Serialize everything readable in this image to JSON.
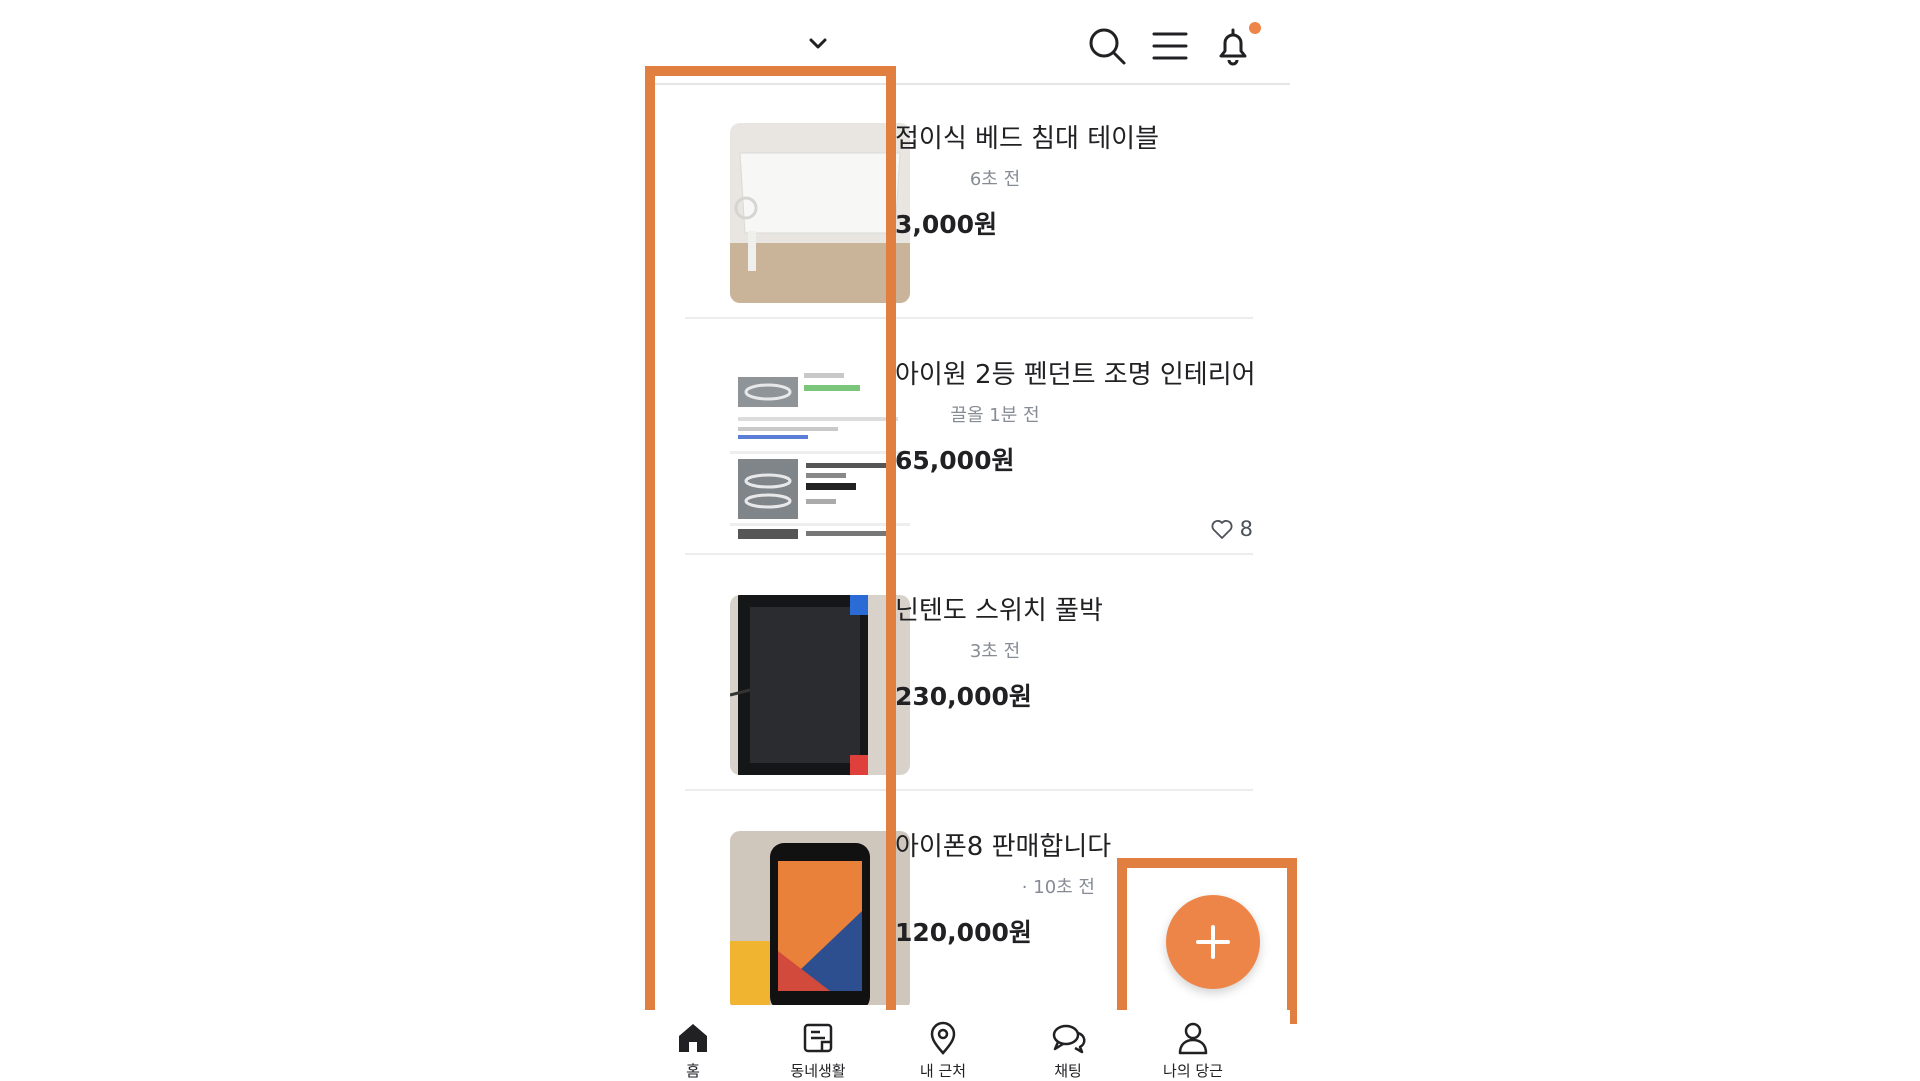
{
  "header": {
    "location_label": "",
    "icons": [
      "chevron-down-icon",
      "search-icon",
      "menu-icon",
      "bell-icon"
    ]
  },
  "colors": {
    "accent": "#ee8548",
    "highlight": "#e07f40"
  },
  "items": [
    {
      "title": "접이식 베드 침대 테이블",
      "meta": "6초 전",
      "price": "3,000원",
      "likes": ""
    },
    {
      "title": "아이원 2등 펜던트 조명 인테리어",
      "meta": "끌올 1분 전",
      "price": "65,000원",
      "likes": "8"
    },
    {
      "title": "닌텐도 스위치 풀박",
      "meta": "3초 전",
      "price": "230,000원",
      "likes": ""
    },
    {
      "title": "아이폰8 판매합니다",
      "meta": "· 10초 전",
      "price": "120,000원",
      "likes": ""
    }
  ],
  "nav": [
    {
      "label": "홈",
      "icon": "home-icon"
    },
    {
      "label": "동네생활",
      "icon": "neighborhood-icon"
    },
    {
      "label": "내 근처",
      "icon": "location-pin-icon"
    },
    {
      "label": "채팅",
      "icon": "chat-icon"
    },
    {
      "label": "나의 당근",
      "icon": "profile-icon"
    }
  ]
}
